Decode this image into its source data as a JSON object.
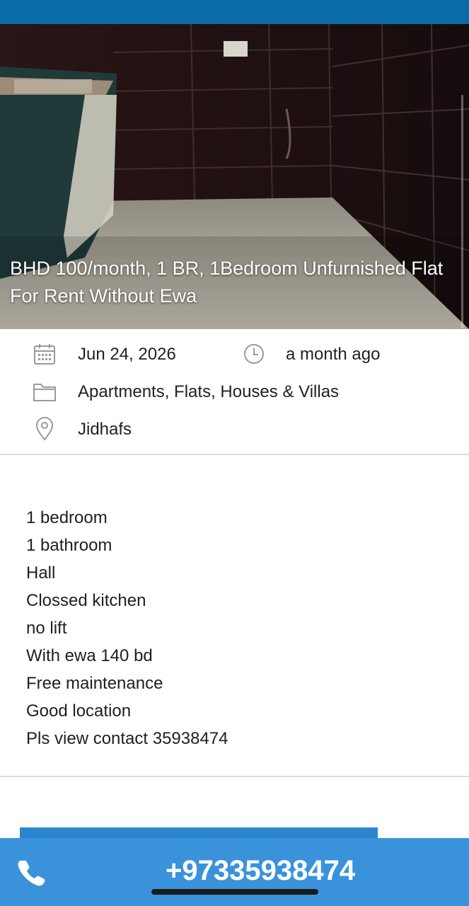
{
  "listing": {
    "title": "BHD 100/month, 1 BR, 1Bedroom Unfurnished Flat For Rent Without Ewa",
    "date": "Jun 24, 2026",
    "posted_ago": "a month ago",
    "category": "Apartments, Flats, Houses & Villas",
    "location": "Jidhafs",
    "description_lines": [
      "1 bedroom",
      "1 bathroom",
      "Hall",
      "Clossed kitchen",
      "no lift",
      "With ewa 140 bd",
      "Free maintenance",
      "Good location",
      "Pls view contact 35938474"
    ]
  },
  "contact": {
    "phone": "+97335938474"
  },
  "icons": {
    "date": "calendar-icon",
    "time": "clock-icon",
    "category": "folder-icon",
    "location": "map-pin-icon",
    "call": "phone-icon"
  },
  "colors": {
    "top_bar": "#0b6aa8",
    "call_bar": "#3a93da",
    "icon_gray": "#9a9a9a"
  }
}
